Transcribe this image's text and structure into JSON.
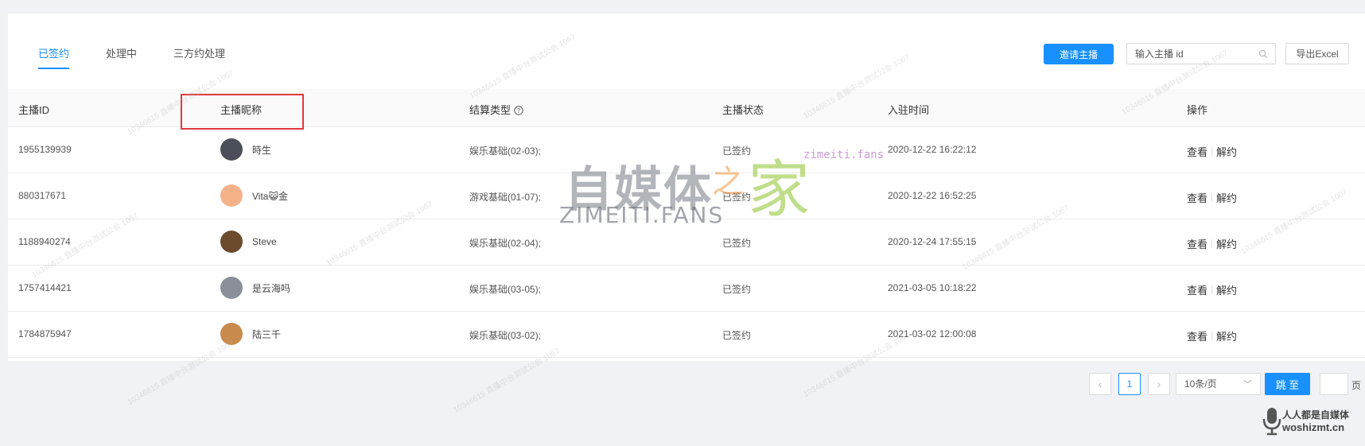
{
  "tabs": [
    {
      "label": "已签约",
      "active": true
    },
    {
      "label": "处理中",
      "active": false
    },
    {
      "label": "三方约处理",
      "active": false
    }
  ],
  "toolbar": {
    "invite_label": "邀请主播",
    "search_placeholder": "输入主播 id",
    "export_label": "导出Excel"
  },
  "table": {
    "columns": [
      "主播ID",
      "主播昵称",
      "结算类型",
      "主播状态",
      "入驻时间",
      "操作"
    ],
    "rows": [
      {
        "id": "1955139939",
        "nickname": "時生",
        "type": "娱乐基础(02-03);",
        "status": "已签约",
        "time": "2020-12-22 16:22:12",
        "avatar_color": "#4a4f5a"
      },
      {
        "id": "880317671",
        "nickname": "Vita😺金",
        "type": "游戏基础(01-07);",
        "status": "已签约",
        "time": "2020-12-22 16:52:25",
        "avatar_color": "#f5b28a"
      },
      {
        "id": "1188940274",
        "nickname": "Steve",
        "type": "娱乐基础(02-04);",
        "status": "已签约",
        "time": "2020-12-24 17:55:15",
        "avatar_color": "#6b4a2e"
      },
      {
        "id": "1757414421",
        "nickname": "是云海吗",
        "type": "娱乐基础(03-05);",
        "status": "已签约",
        "time": "2021-03-05 10:18:22",
        "avatar_color": "#8a8f98"
      },
      {
        "id": "1784875947",
        "nickname": "陆三千",
        "type": "娱乐基础(03-02);",
        "status": "已签约",
        "time": "2021-03-02 12:00:08",
        "avatar_color": "#c98a4e"
      }
    ],
    "action_view": "查看",
    "action_cancel": "解约"
  },
  "pagination": {
    "prev": "‹",
    "current_page": "1",
    "next": "›",
    "page_size": "10条/页",
    "jump_label": "跳 至",
    "page_word": "页"
  },
  "watermark": {
    "logo_cn": "自媒体",
    "logo_zhi": "之",
    "logo_jia": "家",
    "logo_en": "ZIMEITI.FANS",
    "url": "zimeiti.fans",
    "faint": "10346615 直播中台测试公会 1067",
    "corner_cn": "人人都是自媒体",
    "corner_en": "woshizmt.cn"
  },
  "colors": {
    "primary": "#1890ff",
    "highlight": "#e0393e"
  }
}
